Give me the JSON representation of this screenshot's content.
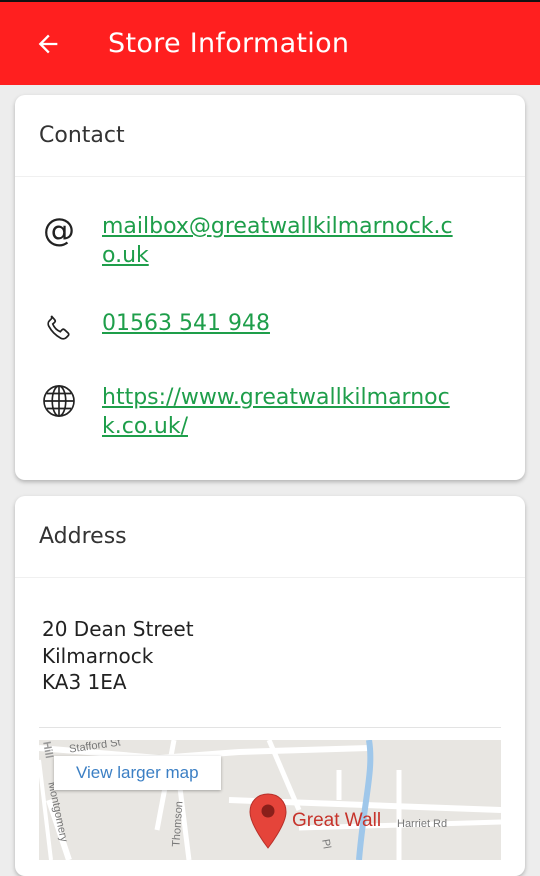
{
  "appbar": {
    "title": "Store Information"
  },
  "contact": {
    "header": "Contact",
    "email": "mailbox@greatwallkilmarnock.co.uk",
    "phone": "01563 541 948",
    "website": "https://www.greatwallkilmarnock.co.uk/"
  },
  "address": {
    "header": "Address",
    "line1": "20 Dean Street",
    "line2": "Kilmarnock",
    "line3": "KA3 1EA"
  },
  "map": {
    "view_larger": "View larger map",
    "pin_label": "Great Wall",
    "streets": [
      "Stafford St",
      "Montgomery",
      "Thomson",
      "Harriet Rd",
      "Hill",
      "Pl"
    ]
  },
  "colors": {
    "appbar": "#ff1f1f",
    "link": "#1e9e4a",
    "pin": "#e5443a"
  }
}
